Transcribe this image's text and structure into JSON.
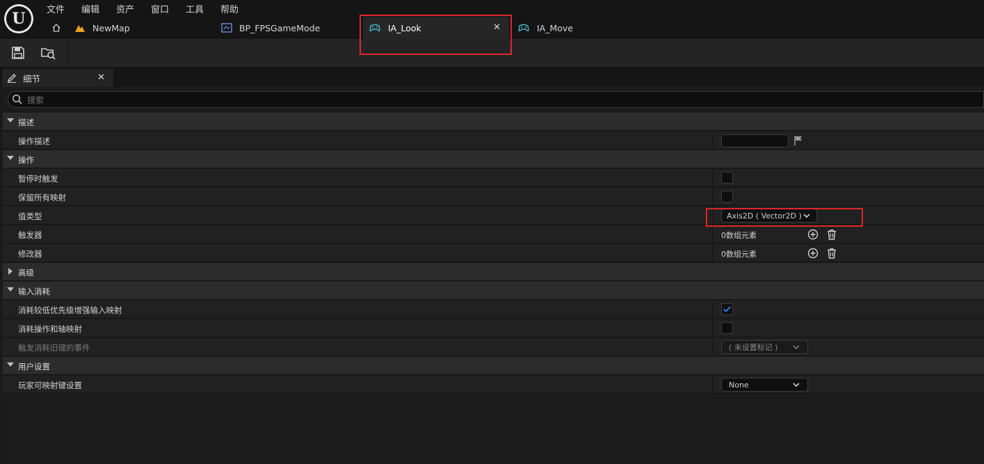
{
  "menu": [
    "文件",
    "编辑",
    "资产",
    "窗口",
    "工具",
    "帮助"
  ],
  "tabs": {
    "newmap": "NewMap",
    "gamemode": "BP_FPSGameMode",
    "active": "IA_Look",
    "move": "IA_Move"
  },
  "details": {
    "tab_label": "细节",
    "search_placeholder": "搜索"
  },
  "sections": {
    "desc": {
      "title": "描述",
      "action_desc": "操作描述"
    },
    "action": {
      "title": "操作",
      "trigger_when_paused": "暂停时触发",
      "reserve_all_mappings": "保留所有映射",
      "value_type": "值类型",
      "value_type_value": "Axis2D ( Vector2D )",
      "triggers": "触发器",
      "triggers_value": "0数组元素",
      "modifiers": "修改器",
      "modifiers_value": "0数组元素"
    },
    "advanced": {
      "title": "高级"
    },
    "input_consumption": {
      "title": "输入消耗",
      "consume_lower_priority": "消耗较低优先级增强输入映射",
      "consume_lower_priority_checked": true,
      "consume_action_axis": "消耗操作和轴映射",
      "trigger_legacy_events": "触发消耗旧键的事件",
      "trigger_legacy_value": "( 未设置标记 )"
    },
    "user_settings": {
      "title": "用户设置",
      "player_mappable": "玩家可映射键设置",
      "player_mappable_value": "None"
    }
  },
  "colors": {
    "highlight": "#e0262c",
    "checkmark": "#2a7cf2",
    "input_action_icon": "#4fb8c8",
    "map_icon": "#e8a020"
  }
}
